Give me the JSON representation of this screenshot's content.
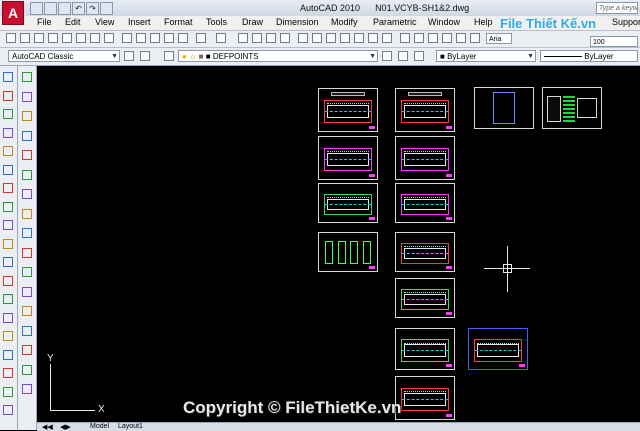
{
  "title_bar": {
    "app_name": "AutoCAD 2010",
    "file_name": "N01.VCYB-SH1&2.dwg",
    "search_placeholder": "Type a keyw"
  },
  "menu": {
    "items": [
      "File",
      "Edit",
      "View",
      "Insert",
      "Format",
      "Tools",
      "Draw",
      "Dimension",
      "Modify",
      "Parametric",
      "Window",
      "Help",
      "Suppor"
    ]
  },
  "toolbar": {
    "font_value": "Aria",
    "text_size_value": "100"
  },
  "properties_bar": {
    "workspace": "AutoCAD Classic",
    "layer": "DEFPOINTS",
    "color": "ByLayer",
    "linetype": "ByLayer"
  },
  "ucs": {
    "y_label": "Y",
    "x_label": "X"
  },
  "tabs": {
    "model": "Model",
    "layout": "Layout1"
  },
  "watermark": {
    "logo_text": "File Thiết Kế.vn",
    "copyright": "Copyright © FileThietKe.vn"
  },
  "colors": {
    "accent_red": "#c8102e",
    "drawing_bg": "#000000",
    "watermark_blue": "#2aa9e8"
  }
}
